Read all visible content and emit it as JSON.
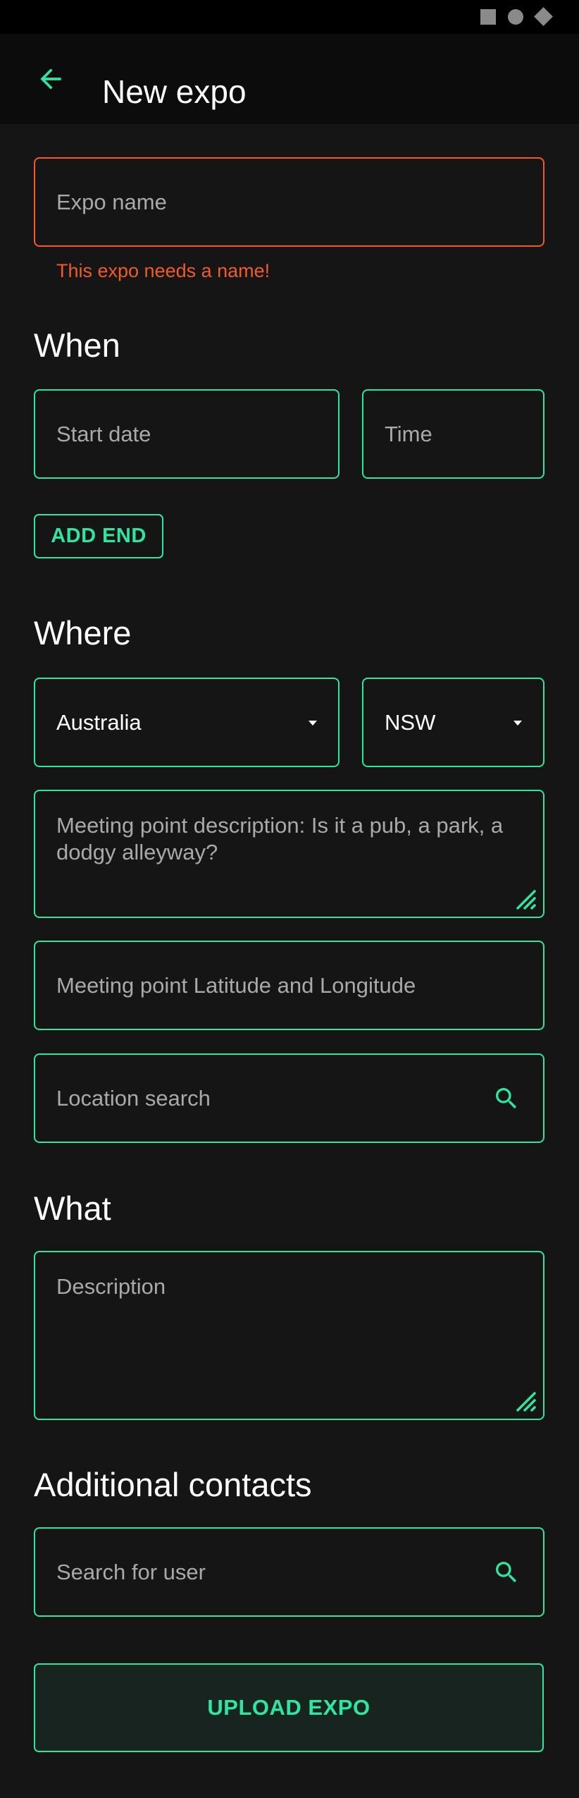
{
  "appbar": {
    "title": "New expo"
  },
  "expo_name": {
    "placeholder": "Expo name",
    "error": "This expo needs a name!"
  },
  "when": {
    "heading": "When",
    "start_date_placeholder": "Start date",
    "time_placeholder": "Time",
    "add_end_label": "ADD END"
  },
  "where": {
    "heading": "Where",
    "country_value": "Australia",
    "state_value": "NSW",
    "meeting_point_placeholder": "Meeting point description: Is it a pub, a park, a dodgy alleyway?",
    "lat_lng_placeholder": "Meeting point Latitude and Longitude",
    "location_search_placeholder": "Location search"
  },
  "what": {
    "heading": "What",
    "description_placeholder": "Description"
  },
  "contacts": {
    "heading": "Additional contacts",
    "search_placeholder": "Search for user"
  },
  "upload_label": "UPLOAD EXPO",
  "colors": {
    "accent": "#2ee6a0",
    "error": "#f25a2a",
    "background": "#151515"
  },
  "icons": [
    "back-arrow-icon",
    "search-icon",
    "dropdown-arrow-icon",
    "resize-handle-icon"
  ]
}
